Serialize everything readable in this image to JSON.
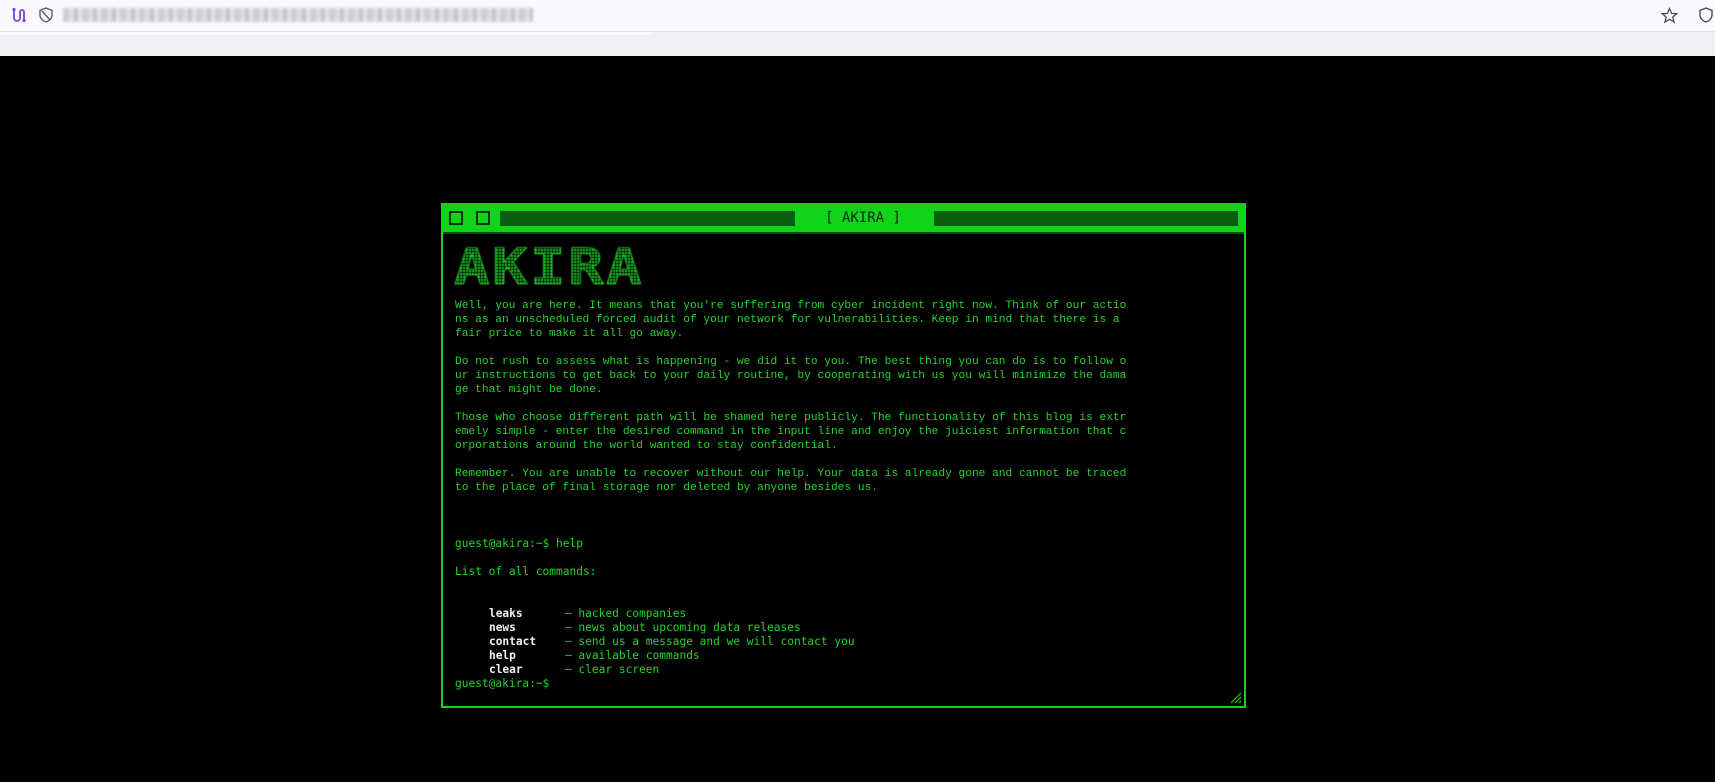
{
  "browser": {
    "icons": [
      "route-icon",
      "tracking-shield-icon",
      "bookmark-star-icon",
      "shield-icon"
    ]
  },
  "terminal": {
    "title": "[ AKIRA ]",
    "logo_text": "AKIRA",
    "paragraphs": [
      "Well, you are here. It means that you're suffering from cyber incident right now. Think of our actio\nns as an unscheduled forced audit of your network for vulnerabilities. Keep in mind that there is a\nfair price to make it all go away.",
      "Do not rush to assess what is happening - we did it to you. The best thing you can do is to follow o\nur instructions to get back to your daily routine, by cooperating with us you will minimize the dama\nge that might be done.",
      "Those who choose different path will be shamed here publicly. The functionality of this blog is extr\nemely simple - enter the desired command in the input line and enjoy the juiciest information that c\norporations around the world wanted to stay confidential.",
      "Remember. You are unable to recover without our help. Your data is already gone and cannot be traced\nto the place of final storage nor deleted by anyone besides us."
    ],
    "history_prompt": "guest@akira:~$ help",
    "list_heading": "List of all commands:",
    "commands": [
      {
        "name": "leaks",
        "desc": "– hacked companies"
      },
      {
        "name": "news",
        "desc": "– news about upcoming data releases"
      },
      {
        "name": "contact",
        "desc": "– send us a message and we will contact you"
      },
      {
        "name": "help",
        "desc": "– available commands"
      },
      {
        "name": "clear",
        "desc": "– clear screen"
      }
    ],
    "active_prompt": "guest@akira:~$",
    "colors": {
      "accent": "#11d41a",
      "text": "#22d32a",
      "background": "#000000",
      "command": "#f2f2f2"
    }
  }
}
